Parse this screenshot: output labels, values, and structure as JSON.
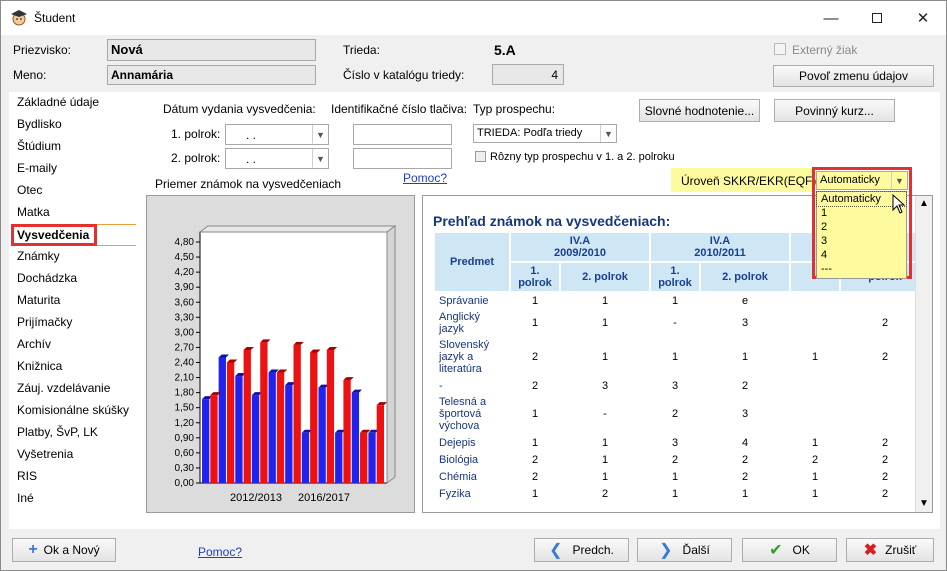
{
  "window": {
    "title": "Študent"
  },
  "header": {
    "surname_label": "Priezvisko:",
    "surname_value": "Nová",
    "name_label": "Meno:",
    "name_value": "Annamária",
    "class_label": "Trieda:",
    "class_value": "5.A",
    "catalog_label": "Číslo v katalógu triedy:",
    "catalog_value": "4",
    "external_label": "Externý žiak",
    "allow_change_label": "Povoľ zmenu údajov"
  },
  "sidebar": {
    "items": [
      {
        "label": "Základné údaje"
      },
      {
        "label": "Bydlisko"
      },
      {
        "label": "Štúdium"
      },
      {
        "label": "E-maily"
      },
      {
        "label": "Otec"
      },
      {
        "label": "Matka"
      },
      {
        "label": "Vysvedčenia"
      },
      {
        "label": "Známky"
      },
      {
        "label": "Dochádzka"
      },
      {
        "label": "Maturita"
      },
      {
        "label": "Prijímačky"
      },
      {
        "label": "Archív"
      },
      {
        "label": "Knižnica"
      },
      {
        "label": "Záuj. vzdelávanie"
      },
      {
        "label": "Komisionálne skúšky"
      },
      {
        "label": "Platby, ŠvP, LK"
      },
      {
        "label": "Vyšetrenia"
      },
      {
        "label": "RIS"
      },
      {
        "label": "Iné"
      }
    ],
    "selected": "Vysvedčenia"
  },
  "form": {
    "date_label": "Dátum vydania vysvedčenia:",
    "sem1_label": "1. polrok:",
    "sem2_label": "2. polrok:",
    "date_placeholder": " .   .",
    "id_label": "Identifikačné číslo tlačiva:",
    "type_label": "Typ prospechu:",
    "type_value": "TRIEDA: Podľa triedy",
    "diff_type_label": "Rôzny typ prospechu v 1. a 2. polroku",
    "verbal_button": "Slovné hodnotenie...",
    "mandatory_button": "Povinný kurz...",
    "help_link": "Pomoc?",
    "skkr_label": "Úroveň SKKR/EKR(EQF):",
    "skkr_value": "Automaticky",
    "skkr_options": [
      "Automaticky",
      "1",
      "2",
      "3",
      "4",
      "---"
    ],
    "chart_title": "Priemer známok na vysvedčeniach"
  },
  "chart_data": {
    "type": "bar",
    "title": "",
    "ylim": [
      0,
      4.8
    ],
    "yticks": [
      "4,80",
      "4,50",
      "4,20",
      "3,90",
      "3,60",
      "3,30",
      "3,00",
      "2,70",
      "2,40",
      "2,10",
      "1,80",
      "1,50",
      "1,20",
      "0,90",
      "0,60",
      "0,30",
      "0,00"
    ],
    "xtick_labels": [
      "2012/2013",
      "2016/2017"
    ],
    "series": [
      {
        "color": "#2222ee",
        "values": [
          1.67,
          2.5,
          2.13,
          1.75,
          2.2,
          1.95,
          1.0,
          1.9,
          1.0,
          1.8,
          1.0
        ]
      },
      {
        "color": "#ee1111",
        "values": [
          1.75,
          2.4,
          2.65,
          2.8,
          2.2,
          2.75,
          2.6,
          2.65,
          2.05,
          1.0,
          1.55
        ]
      }
    ]
  },
  "grades": {
    "title": "Prehľad známok na vysvedčeniach:",
    "subject_header": "Predmet",
    "years": [
      {
        "name": "IV.A",
        "year": "2009/2010"
      },
      {
        "name": "IV.A",
        "year": "2010/2011"
      }
    ],
    "sem_headers": [
      "1. polrok",
      "2. polrok",
      "1. polrok",
      "2. polrok",
      "",
      "polrok"
    ],
    "rows": [
      {
        "subject": "Správanie",
        "g": [
          "1",
          "1",
          "1",
          "e",
          "",
          ""
        ]
      },
      {
        "subject": "Anglický jazyk",
        "g": [
          "1",
          "1",
          "-",
          "3",
          "",
          "2"
        ]
      },
      {
        "subject": "Slovenský jazyk a literatúra",
        "g": [
          "2",
          "1",
          "1",
          "1",
          "1",
          "2"
        ]
      },
      {
        "subject": "-",
        "g": [
          "2",
          "3",
          "3",
          "2",
          "",
          ""
        ]
      },
      {
        "subject": "Telesná a športová výchova",
        "g": [
          "1",
          "-",
          "2",
          "3",
          "",
          ""
        ]
      },
      {
        "subject": "Dejepis",
        "g": [
          "1",
          "1",
          "3",
          "4",
          "1",
          "2"
        ]
      },
      {
        "subject": "Biológia",
        "g": [
          "2",
          "1",
          "2",
          "2",
          "2",
          "2"
        ]
      },
      {
        "subject": "Chémia",
        "g": [
          "2",
          "1",
          "1",
          "2",
          "1",
          "2"
        ]
      },
      {
        "subject": "Fyzika",
        "g": [
          "1",
          "2",
          "1",
          "1",
          "1",
          "2"
        ]
      }
    ]
  },
  "footer": {
    "ok_new": "Ok a Nový",
    "help": "Pomoc?",
    "prev": "Predch.",
    "next": "Ďalší",
    "ok": "OK",
    "cancel": "Zrušiť"
  }
}
